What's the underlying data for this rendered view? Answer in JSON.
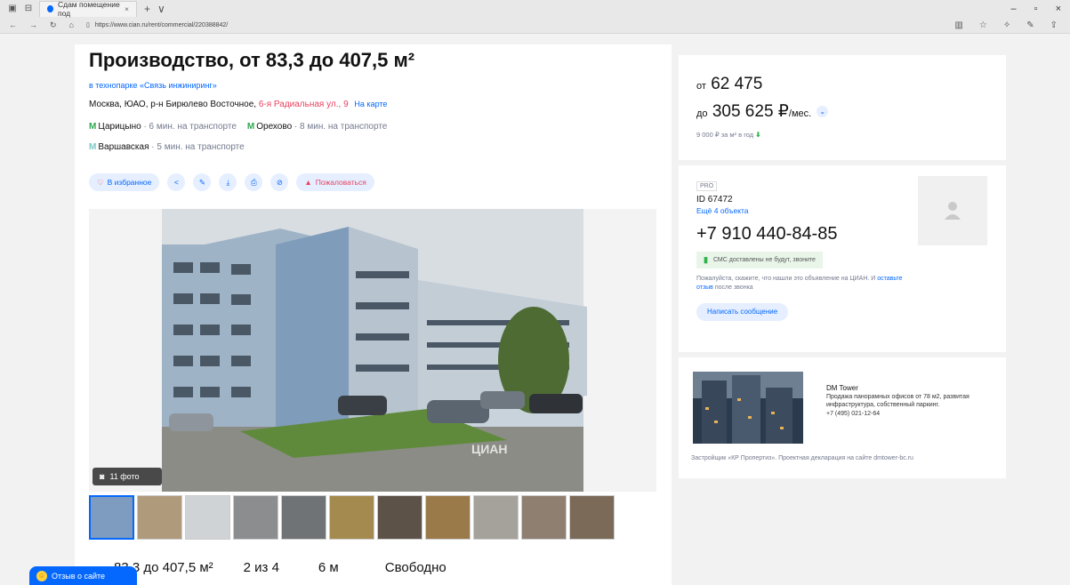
{
  "browser": {
    "tab_title": "Сдам помещение под",
    "url": "https://www.cian.ru/rent/commercial/220388842/",
    "new_tab": "+",
    "tab_list": "∨"
  },
  "listing": {
    "title": "Производство, от 83,3 до 407,5 м²",
    "complex": "в технопарке «Связь инжиниринг»",
    "address_prefix": "Москва, ЮАО, р-н Бирюлево Восточное, ",
    "address_street": "6-я Радиальная ул., 9",
    "map_link": "На карте",
    "metro": [
      {
        "name": "Царицыно",
        "time": "· 6 мин. на транспорте",
        "color": "#2fa84f"
      },
      {
        "name": "Орехово",
        "time": "· 8 мин. на транспорте",
        "color": "#2fa84f"
      },
      {
        "name": "Варшавская",
        "time": "· 5 мин. на транспорте",
        "color": "#7bc8c6"
      }
    ],
    "favorite_label": "В избранное",
    "complain_label": "Пожаловаться",
    "photo_count": "11 фото",
    "watermark": "ЦИАН",
    "facts": [
      {
        "value": "83,3 до 407,5 м²"
      },
      {
        "value": "2 из 4"
      },
      {
        "value": "6 м"
      },
      {
        "value": "Свободно"
      }
    ]
  },
  "price": {
    "from_prefix": "от",
    "from_value": "62 475",
    "to_prefix": "до",
    "to_value": "305 625 ₽",
    "to_suffix": "/мес.",
    "per_meter": "9 000 ₽ за м² в год"
  },
  "seller": {
    "badge": "PRO",
    "id": "ID 67472",
    "more": "Ещё 4 объекта",
    "phone": "+7 910 440-84-85",
    "sms": "СМС доставлены не будут, звоните",
    "note_1": "Пожалуйста, скажите, что нашли это объявление на ЦИАН. И ",
    "note_link": "оставьте отзыв",
    "note_2": " после звонка",
    "message_button": "Написать сообщение"
  },
  "ad": {
    "name": "DM Tower",
    "text": "Продажа панорамных офисов от 78 м2, развитая инфраструктура, собственный паркинг.",
    "phone": "+7 (495) 021-12-64",
    "footer": "Застройщик «КР Пропертиз». Проектная декларация на сайте dmtower-bc.ru"
  },
  "feedback_label": "Отзыв о сайте",
  "colors": {
    "accent": "#0468ff",
    "red": "#e84260",
    "metro_green": "#2fa84f"
  }
}
